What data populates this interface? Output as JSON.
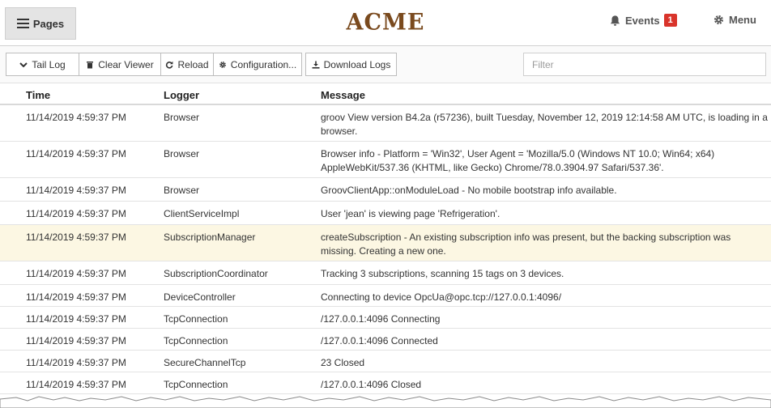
{
  "header": {
    "pages_label": "Pages",
    "brand": "ACME",
    "events_label": "Events",
    "events_count": "1",
    "menu_label": "Menu"
  },
  "toolbar": {
    "tail_log": "Tail Log",
    "clear_viewer": "Clear Viewer",
    "reload": "Reload",
    "configuration": "Configuration...",
    "download_logs": "Download Logs",
    "filter_placeholder": "Filter"
  },
  "table": {
    "columns": [
      "Time",
      "Logger",
      "Message"
    ],
    "rows": [
      {
        "time": "11/14/2019 4:59:37 PM",
        "logger": "Browser",
        "message": "groov View version B4.2a (r57236), built Tuesday, November 12, 2019 12:14:58 AM UTC, is loading in a browser."
      },
      {
        "time": "11/14/2019 4:59:37 PM",
        "logger": "Browser",
        "message": "Browser info - Platform = 'Win32', User Agent = 'Mozilla/5.0 (Windows NT 10.0; Win64; x64) AppleWebKit/537.36 (KHTML, like Gecko) Chrome/78.0.3904.97 Safari/537.36'."
      },
      {
        "time": "11/14/2019 4:59:37 PM",
        "logger": "Browser",
        "message": "GroovClientApp::onModuleLoad - No mobile bootstrap info available."
      },
      {
        "time": "11/14/2019 4:59:37 PM",
        "logger": "ClientServiceImpl",
        "message": "User 'jean' is viewing page 'Refrigeration'."
      },
      {
        "time": "11/14/2019 4:59:37 PM",
        "logger": "SubscriptionManager",
        "message": "createSubscription - An existing subscription info was present, but the backing subscription was missing. Creating a new one.",
        "highlighted": true
      },
      {
        "time": "11/14/2019 4:59:37 PM",
        "logger": "SubscriptionCoordinator",
        "message": "Tracking 3 subscriptions, scanning 15 tags on 3 devices."
      },
      {
        "time": "11/14/2019 4:59:37 PM",
        "logger": "DeviceController",
        "message": "Connecting to device OpcUa@opc.tcp://127.0.0.1:4096/"
      },
      {
        "time": "11/14/2019 4:59:37 PM",
        "logger": "TcpConnection",
        "message": "/127.0.0.1:4096 Connecting"
      },
      {
        "time": "11/14/2019 4:59:37 PM",
        "logger": "TcpConnection",
        "message": "/127.0.0.1:4096 Connected"
      },
      {
        "time": "11/14/2019 4:59:37 PM",
        "logger": "SecureChannelTcp",
        "message": "23 Closed"
      },
      {
        "time": "11/14/2019 4:59:37 PM",
        "logger": "TcpConnection",
        "message": "/127.0.0.1:4096 Closed"
      }
    ]
  },
  "colors": {
    "brand": "#7a4a1e",
    "badge": "#d9342b",
    "highlight_row": "#fcf7e3"
  }
}
